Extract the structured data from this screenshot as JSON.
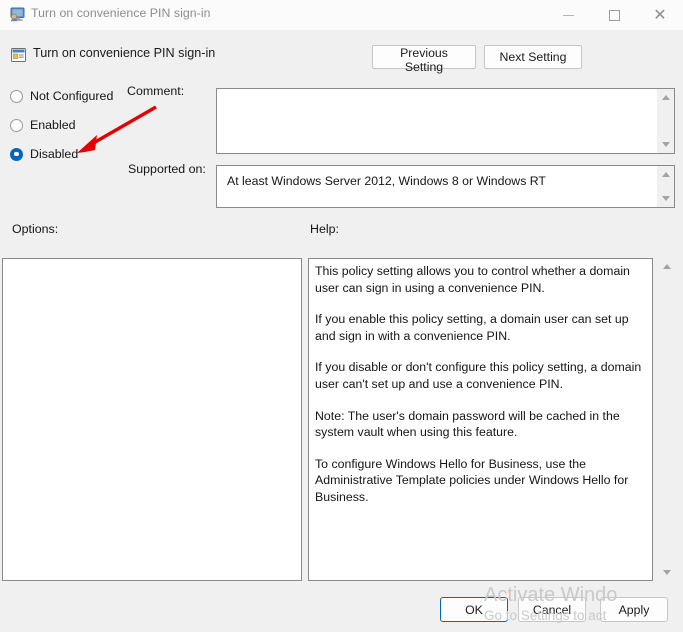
{
  "window": {
    "title": "Turn on convenience PIN sign-in",
    "icon": "policy-monitor-icon",
    "controls": {
      "minimize": "minimize-icon",
      "maximize": "maximize-icon",
      "close": "close-icon"
    }
  },
  "header": {
    "title": "Turn on convenience PIN sign-in",
    "icon": "group-policy-setting-icon",
    "previous_setting": "Previous Setting",
    "next_setting": "Next Setting"
  },
  "state_options": [
    {
      "label": "Not Configured",
      "checked": false
    },
    {
      "label": "Enabled",
      "checked": false
    },
    {
      "label": "Disabled",
      "checked": true
    }
  ],
  "fields": {
    "comment_label": "Comment:",
    "comment_value": "",
    "supported_label": "Supported on:",
    "supported_value": "At least Windows Server 2012, Windows 8 or Windows RT"
  },
  "panels": {
    "options_label": "Options:",
    "help_label": "Help:",
    "help_paragraphs": [
      "This policy setting allows you to control whether a domain user can sign in using a convenience PIN.",
      "If you enable this policy setting, a domain user can set up and sign in with a convenience PIN.",
      "If you disable or don't configure this policy setting, a domain user can't set up and use a convenience PIN.",
      "Note: The user's domain password will be cached in the system vault when using this feature.",
      "To configure Windows Hello for Business, use the Administrative Template policies under Windows Hello for Business."
    ]
  },
  "buttons": {
    "ok": "OK",
    "cancel": "Cancel",
    "apply": "Apply"
  },
  "watermark": {
    "line1": "Activate Windo",
    "line2": "Go to Settings to act"
  },
  "colors": {
    "accent": "#0067c0",
    "annotation_arrow": "#e30000",
    "window_bg": "#f0f0f0",
    "field_bg": "#ffffff",
    "watermark": "#c9c9c9"
  },
  "annotation": {
    "arrow_target": "Disabled"
  }
}
